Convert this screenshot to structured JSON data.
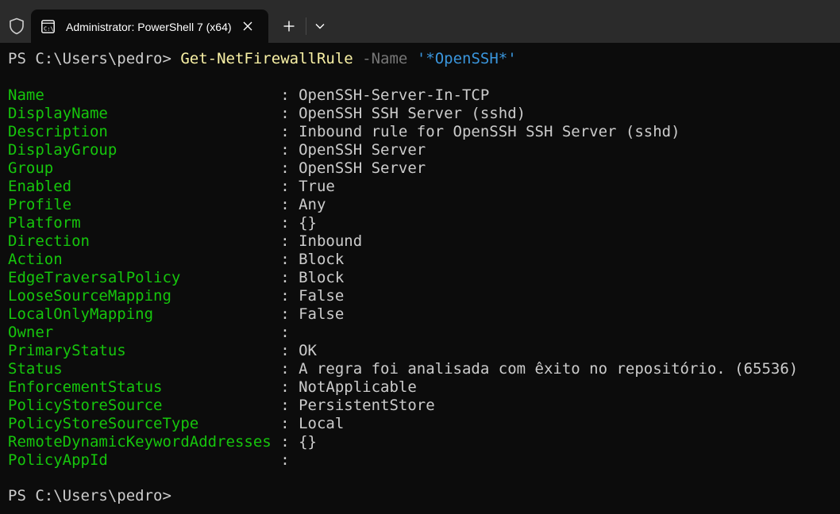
{
  "window": {
    "tab_title": "Administrator: PowerShell 7 (x64)"
  },
  "terminal": {
    "command": {
      "prompt": "PS C:\\Users\\pedro>",
      "cmdlet": "Get-NetFirewallRule",
      "parameter": "-Name",
      "argument": "'*OpenSSH*'"
    },
    "properties": [
      {
        "name": "Name",
        "value": "OpenSSH-Server-In-TCP"
      },
      {
        "name": "DisplayName",
        "value": "OpenSSH SSH Server (sshd)"
      },
      {
        "name": "Description",
        "value": "Inbound rule for OpenSSH SSH Server (sshd)"
      },
      {
        "name": "DisplayGroup",
        "value": "OpenSSH Server"
      },
      {
        "name": "Group",
        "value": "OpenSSH Server"
      },
      {
        "name": "Enabled",
        "value": "True"
      },
      {
        "name": "Profile",
        "value": "Any"
      },
      {
        "name": "Platform",
        "value": "{}"
      },
      {
        "name": "Direction",
        "value": "Inbound"
      },
      {
        "name": "Action",
        "value": "Block"
      },
      {
        "name": "EdgeTraversalPolicy",
        "value": "Block"
      },
      {
        "name": "LooseSourceMapping",
        "value": "False"
      },
      {
        "name": "LocalOnlyMapping",
        "value": "False"
      },
      {
        "name": "Owner",
        "value": ""
      },
      {
        "name": "PrimaryStatus",
        "value": "OK"
      },
      {
        "name": "Status",
        "value": "A regra foi analisada com êxito no repositório. (65536)"
      },
      {
        "name": "EnforcementStatus",
        "value": "NotApplicable"
      },
      {
        "name": "PolicyStoreSource",
        "value": "PersistentStore"
      },
      {
        "name": "PolicyStoreSourceType",
        "value": "Local"
      },
      {
        "name": "RemoteDynamicKeywordAddresses",
        "value": "{}"
      },
      {
        "name": "PolicyAppId",
        "value": ""
      }
    ],
    "separator": ":",
    "final_prompt": "PS C:\\Users\\pedro>"
  },
  "colors": {
    "background": "#0c0c0c",
    "titlebar": "#2b2b2b",
    "property": "#16c60c",
    "cmdlet": "#f9f1a5",
    "parameter": "#767676",
    "string": "#3a96dd",
    "text": "#cccccc"
  },
  "icons": {
    "shield": "shield-icon",
    "tab": "terminal-icon",
    "close": "close-icon",
    "new_tab": "plus-icon",
    "dropdown": "chevron-down-icon"
  }
}
